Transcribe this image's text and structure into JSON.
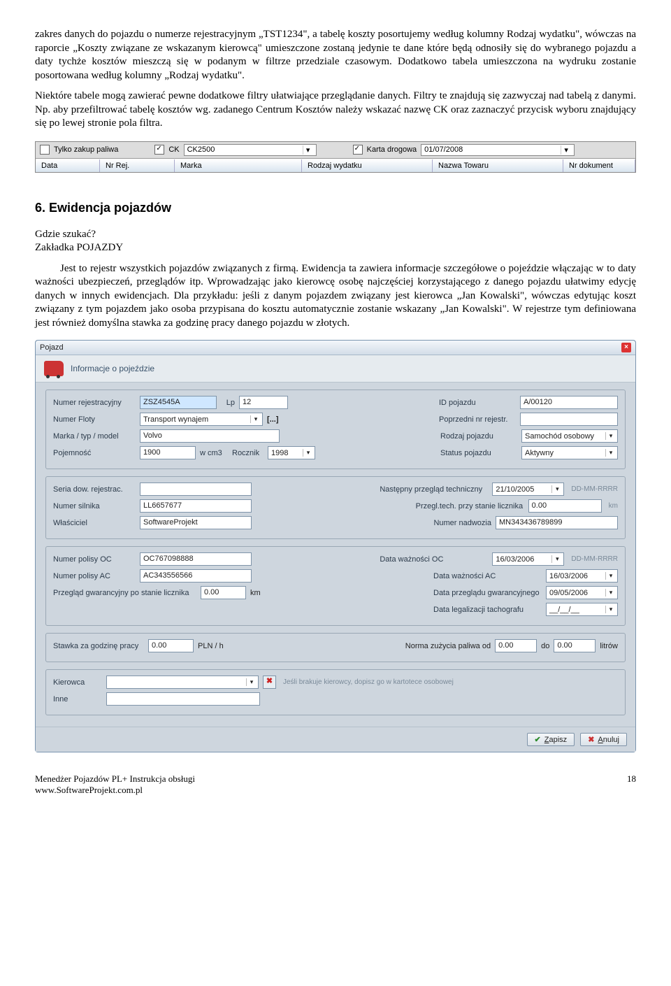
{
  "para1": "zakres danych do pojazdu o numerze rejestracyjnym „TST1234\", a tabelę koszty posortujemy według kolumny Rodzaj wydatku\", wówczas na raporcie „Koszty związane ze wskazanym kierowcą\" umieszczone zostaną jedynie te dane które będą odnosiły się do wybranego pojazdu a daty tychże kosztów mieszczą się w podanym w filtrze przedziale czasowym. Dodatkowo tabela umieszczona na wydruku zostanie posortowana według kolumny „Rodzaj wydatku\".",
  "para2": "Niektóre tabele mogą zawierać pewne dodatkowe filtry ułatwiające przeglądanie danych. Filtry te znajdują się zazwyczaj nad tabelą z danymi. Np. aby przefiltrować tabelę kosztów wg. zadanego Centrum Kosztów należy wskazać nazwę CK oraz zaznaczyć przycisk wyboru znajdujący się po lewej stronie pola filtra.",
  "filter": {
    "only_fuel": "Tylko zakup paliwa",
    "ck_label": "CK",
    "ck_value": "CK2500",
    "road_card": "Karta drogowa",
    "road_value": "01/07/2008",
    "headers": [
      "Data",
      "Nr Rej.",
      "Marka",
      "Rodzaj wydatku",
      "Nazwa Towaru",
      "Nr dokument"
    ]
  },
  "section_title": "6.   Ewidencja pojazdów",
  "where": "Gdzie szukać?",
  "tab": "Zakładka POJAZDY",
  "para3": "Jest to rejestr wszystkich pojazdów związanych z firmą. Ewidencja ta zawiera informacje szczegółowe o pojeździe włączając w to daty ważności ubezpieczeń, przeglądów itp. Wprowadzając jako kierowcę osobę najczęściej korzystającego z danego pojazdu ułatwimy edycję danych w innych ewidencjach. Dla przykładu: jeśli z danym pojazdem związany jest kierowca „Jan Kowalski\", wówczas edytując koszt związany z tym pojazdem jako osoba przypisana do kosztu automatycznie zostanie wskazany „Jan Kowalski\". W rejestrze tym definiowana jest również domyślna stawka za godzinę pracy danego pojazdu w złotych.",
  "form": {
    "window_title": "Pojazd",
    "header": "Informacje o pojeździe",
    "reg_label": "Numer rejestracyjny",
    "reg_value": "ZSZ4545A",
    "lp_label": "Lp",
    "lp_value": "12",
    "id_label": "ID pojazdu",
    "id_value": "A/00120",
    "fleet_label": "Numer Floty",
    "fleet_value": "Transport wynajem",
    "fleet_btn": "[...]",
    "prev_reg_label": "Poprzedni nr rejestr.",
    "prev_reg_value": "",
    "make_label": "Marka / typ / model",
    "make_value": "Volvo",
    "type_label": "Rodzaj pojazdu",
    "type_value": "Samochód osobowy",
    "cap_label": "Pojemność",
    "cap_value": "1900",
    "cap_unit": "w cm3",
    "year_label": "Rocznik",
    "year_value": "1998",
    "status_label": "Status pojazdu",
    "status_value": "Aktywny",
    "series_label": "Seria dow. rejestrac.",
    "series_value": "",
    "next_tech_label": "Następny przegląd techniczny",
    "next_tech_value": "21/10/2005",
    "date_hint": "DD-MM-RRRR",
    "engine_label": "Numer silnika",
    "engine_value": "LL6657677",
    "tech_odo_label": "Przegl.tech. przy stanie licznika",
    "tech_odo_value": "0.00",
    "km": "km",
    "owner_label": "Właściciel",
    "owner_value": "SoftwareProjekt",
    "body_label": "Numer nadwozia",
    "body_value": "MN343436789899",
    "oc_label": "Numer polisy OC",
    "oc_value": "OC767098888",
    "oc_date_label": "Data ważności OC",
    "oc_date_value": "16/03/2006",
    "ac_label": "Numer polisy AC",
    "ac_value": "AC343556566",
    "ac_date_label": "Data ważności AC",
    "ac_date_value": "16/03/2006",
    "warranty_label": "Przegląd gwarancyjny po stanie licznika",
    "warranty_value": "0.00",
    "warranty_date_label": "Data przeglądu gwarancyjnego",
    "warranty_date_value": "09/05/2006",
    "tacho_label": "Data legalizacji tachografu",
    "tacho_value": "__/__/__",
    "rate_label": "Stawka za godzinę pracy",
    "rate_value": "0.00",
    "rate_unit": "PLN / h",
    "norm_label": "Norma zużycia paliwa od",
    "norm_from": "0.00",
    "norm_to_label": "do",
    "norm_to": "0.00",
    "norm_unit": "litrów",
    "driver_label": "Kierowca",
    "driver_value": "",
    "driver_hint": "Jeśli brakuje kierowcy, dopisz go w kartotece osobowej",
    "other_label": "Inne",
    "other_value": "",
    "save": "Zapisz",
    "cancel": "Anuluj"
  },
  "footer_left1": "Menedżer Pojazdów PL+ Instrukcja obsługi",
  "footer_left2": "www.SoftwareProjekt.com.pl",
  "footer_right": "18"
}
